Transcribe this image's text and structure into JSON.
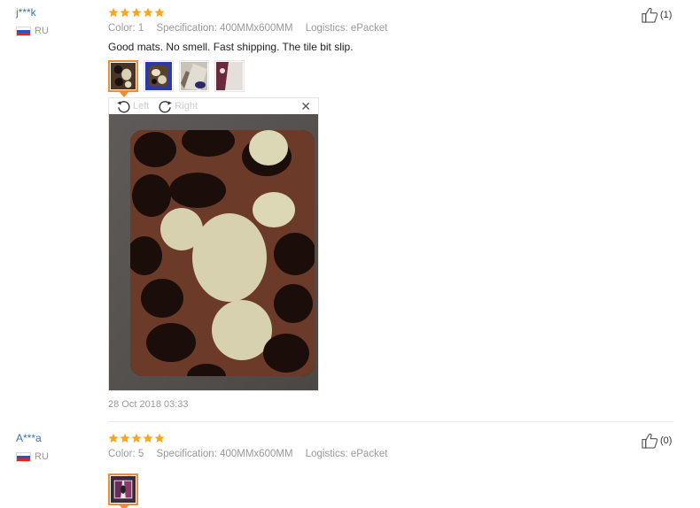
{
  "reviews": [
    {
      "username": "j***k",
      "country": "RU",
      "stars": 5,
      "color": "Color: 1",
      "specification": "Specification: 400MMx600MM",
      "logistics": "Logistics: ePacket",
      "feedback": "Good mats. No smell. Fast shipping. The tile bit slip.",
      "like_count": "(1)",
      "date": "28 Oct 2018 03:33",
      "viewer": {
        "rotate_left_label": "Left",
        "rotate_right_label": "Right"
      }
    },
    {
      "username": "A***a",
      "country": "RU",
      "stars": 5,
      "color": "Color: 5",
      "specification": "Specification: 400MMx600MM",
      "logistics": "Logistics: ePacket",
      "like_count": "(0)"
    }
  ],
  "colors": {
    "star": "#f5a623",
    "selected_border": "#f08a35",
    "username": "#3a6ec4"
  },
  "icons": [
    "thumbs-up-icon",
    "rotate-left-icon",
    "rotate-right-icon",
    "close-icon",
    "star-icon",
    "flag-ru-icon"
  ]
}
